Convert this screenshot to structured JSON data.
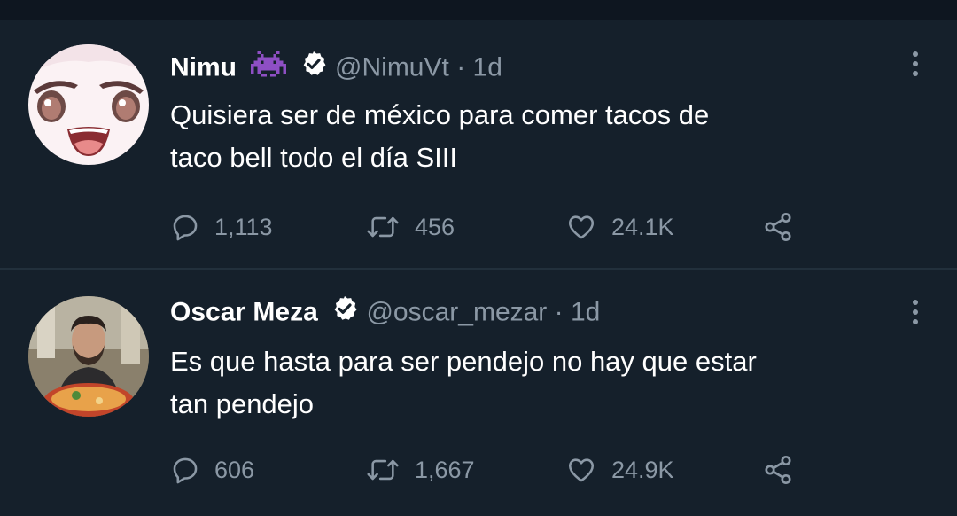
{
  "tweets": [
    {
      "name": "Nimu",
      "handle": "@NimuVt",
      "separator": "·",
      "time": "1d",
      "text_lines": [
        "Quisiera ser de méxico para comer tacos de",
        "taco bell todo el día SIII"
      ],
      "stats": {
        "replies": "1,113",
        "retweets": "456",
        "likes": "24.1K"
      },
      "name_emoji_icon": "space-invader-icon",
      "verified": true
    },
    {
      "name": "Oscar Meza",
      "handle": "@oscar_mezar",
      "separator": "·",
      "time": "1d",
      "text_lines": [
        "Es que hasta para ser pendejo no hay que estar",
        "tan pendejo"
      ],
      "stats": {
        "replies": "606",
        "retweets": "1,667",
        "likes": "24.9K"
      },
      "verified": true
    }
  ],
  "colors": {
    "background": "#15202b",
    "secondary_text": "#8b98a5",
    "divider": "#22303c",
    "emoji_purple": "#8e4fc4"
  }
}
